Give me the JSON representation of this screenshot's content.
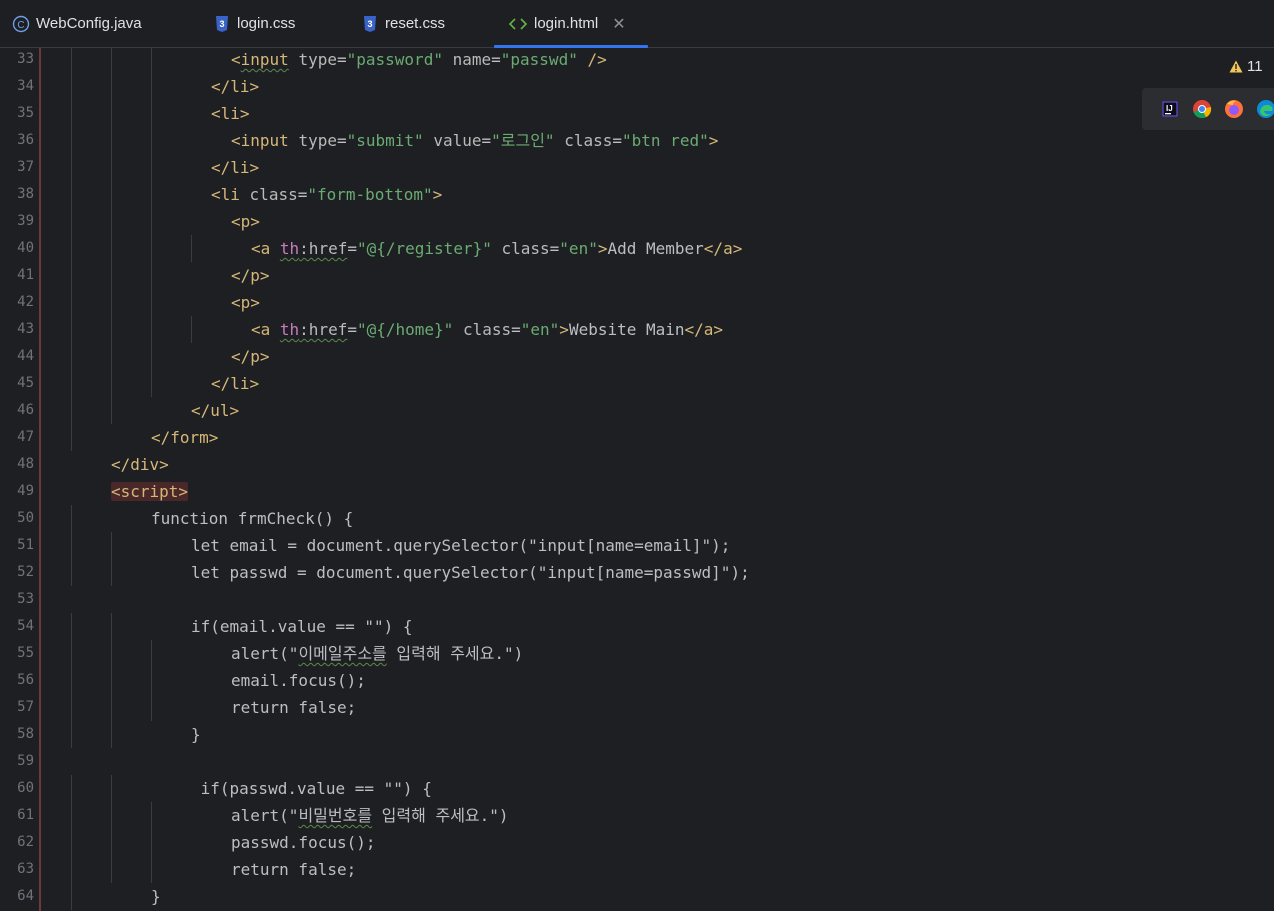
{
  "tabs": [
    {
      "label": "WebConfig.java",
      "icon": "java-class-icon"
    },
    {
      "label": "login.css",
      "icon": "css-file-icon"
    },
    {
      "label": "reset.css",
      "icon": "css-file-icon"
    },
    {
      "label": "login.html",
      "icon": "html-file-icon",
      "active": true,
      "close": "✕"
    }
  ],
  "warnings": {
    "count": "11"
  },
  "browsers": [
    "intellij-icon",
    "chrome-icon",
    "firefox-icon",
    "edge-icon"
  ],
  "lines": [
    {
      "n": "33",
      "indent": 8,
      "segs": [
        [
          "tag",
          "<"
        ],
        [
          "tag squig",
          "input"
        ],
        [
          "plain",
          " "
        ],
        [
          "attr",
          "type"
        ],
        [
          "plain",
          "="
        ],
        [
          "str",
          "\"password\""
        ],
        [
          "plain",
          " "
        ],
        [
          "attr",
          "name"
        ],
        [
          "plain",
          "="
        ],
        [
          "str",
          "\"passwd\""
        ],
        [
          "plain",
          " "
        ],
        [
          "tag",
          "/>"
        ]
      ]
    },
    {
      "n": "34",
      "indent": 7,
      "segs": [
        [
          "tag",
          "</li>"
        ]
      ]
    },
    {
      "n": "35",
      "indent": 7,
      "segs": [
        [
          "tag",
          "<li>"
        ]
      ]
    },
    {
      "n": "36",
      "indent": 8,
      "segs": [
        [
          "tag",
          "<input"
        ],
        [
          "plain",
          " "
        ],
        [
          "attr",
          "type"
        ],
        [
          "plain",
          "="
        ],
        [
          "str",
          "\"submit\""
        ],
        [
          "plain",
          " "
        ],
        [
          "attr",
          "value"
        ],
        [
          "plain",
          "="
        ],
        [
          "str",
          "\"로그인\""
        ],
        [
          "plain",
          " "
        ],
        [
          "attr",
          "class"
        ],
        [
          "plain",
          "="
        ],
        [
          "str",
          "\"btn red\""
        ],
        [
          "tag",
          ">"
        ]
      ]
    },
    {
      "n": "37",
      "indent": 7,
      "segs": [
        [
          "tag",
          "</li>"
        ]
      ]
    },
    {
      "n": "38",
      "indent": 7,
      "segs": [
        [
          "tag",
          "<li"
        ],
        [
          "plain",
          " "
        ],
        [
          "attr",
          "class"
        ],
        [
          "plain",
          "="
        ],
        [
          "str",
          "\"form-bottom\""
        ],
        [
          "tag",
          ">"
        ]
      ]
    },
    {
      "n": "39",
      "indent": 8,
      "segs": [
        [
          "tag",
          "<p>"
        ]
      ]
    },
    {
      "n": "40",
      "indent": 9,
      "segs": [
        [
          "tag",
          "<a"
        ],
        [
          "plain",
          " "
        ],
        [
          "ns squig",
          "th"
        ],
        [
          "attr squig",
          ":href"
        ],
        [
          "plain",
          "="
        ],
        [
          "str",
          "\"@{/register}\""
        ],
        [
          "plain",
          " "
        ],
        [
          "attr",
          "class"
        ],
        [
          "plain",
          "="
        ],
        [
          "str",
          "\"en\""
        ],
        [
          "tag",
          ">"
        ],
        [
          "plain",
          "Add Member"
        ],
        [
          "tag",
          "</a>"
        ]
      ]
    },
    {
      "n": "41",
      "indent": 8,
      "segs": [
        [
          "tag",
          "</p>"
        ]
      ]
    },
    {
      "n": "42",
      "indent": 8,
      "segs": [
        [
          "tag",
          "<p>"
        ]
      ]
    },
    {
      "n": "43",
      "indent": 9,
      "segs": [
        [
          "tag",
          "<a"
        ],
        [
          "plain",
          " "
        ],
        [
          "ns squig",
          "th"
        ],
        [
          "attr squig",
          ":href"
        ],
        [
          "plain",
          "="
        ],
        [
          "str",
          "\"@{/home}\""
        ],
        [
          "plain",
          " "
        ],
        [
          "attr",
          "class"
        ],
        [
          "plain",
          "="
        ],
        [
          "str",
          "\"en\""
        ],
        [
          "tag",
          ">"
        ],
        [
          "plain",
          "Website Main"
        ],
        [
          "tag",
          "</a>"
        ]
      ]
    },
    {
      "n": "44",
      "indent": 8,
      "segs": [
        [
          "tag",
          "</p>"
        ]
      ]
    },
    {
      "n": "45",
      "indent": 7,
      "segs": [
        [
          "tag",
          "</li>"
        ]
      ]
    },
    {
      "n": "46",
      "indent": 6,
      "segs": [
        [
          "tag",
          "</ul>"
        ]
      ]
    },
    {
      "n": "47",
      "indent": 4,
      "segs": [
        [
          "tag",
          "</form>"
        ]
      ]
    },
    {
      "n": "48",
      "indent": 2,
      "segs": [
        [
          "tag",
          "</div>"
        ]
      ]
    },
    {
      "n": "49",
      "indent": 2,
      "segs": [
        [
          "tag hl",
          "<script>"
        ]
      ]
    },
    {
      "n": "50",
      "indent": 4,
      "segs": [
        [
          "plain",
          "function frmCheck() {"
        ]
      ]
    },
    {
      "n": "51",
      "indent": 6,
      "segs": [
        [
          "plain",
          "let email = document.querySelector(\"input[name=email]\");"
        ]
      ]
    },
    {
      "n": "52",
      "indent": 6,
      "segs": [
        [
          "plain",
          "let passwd = document.querySelector(\"input[name=passwd]\");"
        ]
      ]
    },
    {
      "n": "53",
      "indent": 0,
      "segs": []
    },
    {
      "n": "54",
      "indent": 6,
      "segs": [
        [
          "plain",
          "if(email.value == \"\") {"
        ]
      ]
    },
    {
      "n": "55",
      "indent": 8,
      "segs": [
        [
          "plain",
          "alert(\""
        ],
        [
          "plain squig",
          "이메일주소를"
        ],
        [
          "plain",
          " 입력해 주세요.\")"
        ]
      ]
    },
    {
      "n": "56",
      "indent": 8,
      "segs": [
        [
          "plain",
          "email.focus();"
        ]
      ]
    },
    {
      "n": "57",
      "indent": 8,
      "segs": [
        [
          "plain",
          "return false;"
        ]
      ]
    },
    {
      "n": "58",
      "indent": 6,
      "segs": [
        [
          "plain",
          "}"
        ]
      ]
    },
    {
      "n": "59",
      "indent": 0,
      "segs": []
    },
    {
      "n": "60",
      "indent": 6,
      "segs": [
        [
          "plain",
          " if(passwd.value == \"\") {"
        ]
      ]
    },
    {
      "n": "61",
      "indent": 8,
      "segs": [
        [
          "plain",
          "alert(\""
        ],
        [
          "plain squig",
          "비밀번호를"
        ],
        [
          "plain",
          " 입력해 주세요.\")"
        ]
      ]
    },
    {
      "n": "62",
      "indent": 8,
      "segs": [
        [
          "plain",
          "passwd.focus();"
        ]
      ]
    },
    {
      "n": "63",
      "indent": 8,
      "segs": [
        [
          "plain",
          "return false;"
        ]
      ]
    },
    {
      "n": "64",
      "indent": 4,
      "segs": [
        [
          "plain",
          "}"
        ]
      ]
    }
  ]
}
